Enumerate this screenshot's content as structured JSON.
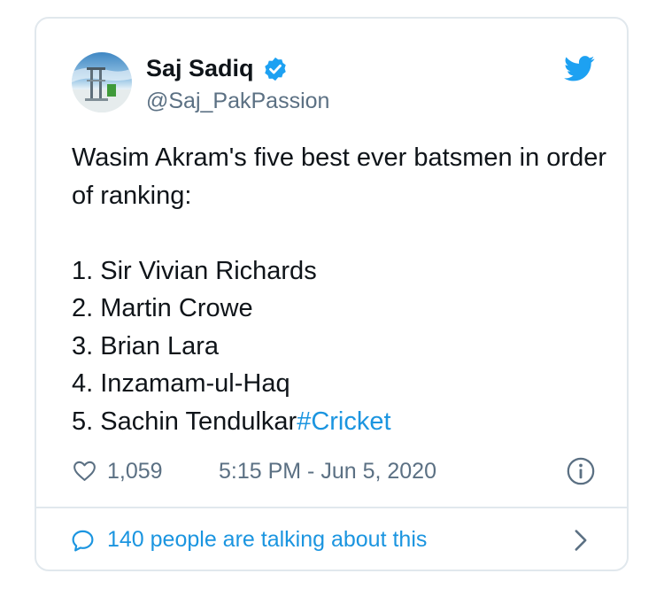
{
  "tweet": {
    "author": {
      "name": "Saj Sadiq",
      "handle": "@Saj_PakPassion",
      "verified": true
    },
    "text": {
      "intro": "Wasim Akram's five best ever batsmen in order of ranking:",
      "list": [
        "1. Sir Vivian Richards",
        "2. Martin Crowe",
        "3. Brian Lara",
        "4. Inzamam-ul-Haq",
        "5. Sachin Tendulkar"
      ],
      "hashtag": "#Cricket"
    },
    "likes": "1,059",
    "timestamp": "5:15 PM - Jun 5, 2020",
    "conversation": "140 people are talking about this"
  },
  "colors": {
    "accent": "#1b95e0",
    "twitter_blue": "#1da1f2",
    "muted": "#5b7083",
    "border": "#e1e8ed",
    "text": "#0f1419"
  },
  "icons": {
    "verified": "verified-badge-icon",
    "brand": "twitter-bird-icon",
    "like": "heart-icon",
    "info": "info-icon",
    "conversation": "speech-bubble-icon",
    "go": "chevron-right-icon"
  }
}
